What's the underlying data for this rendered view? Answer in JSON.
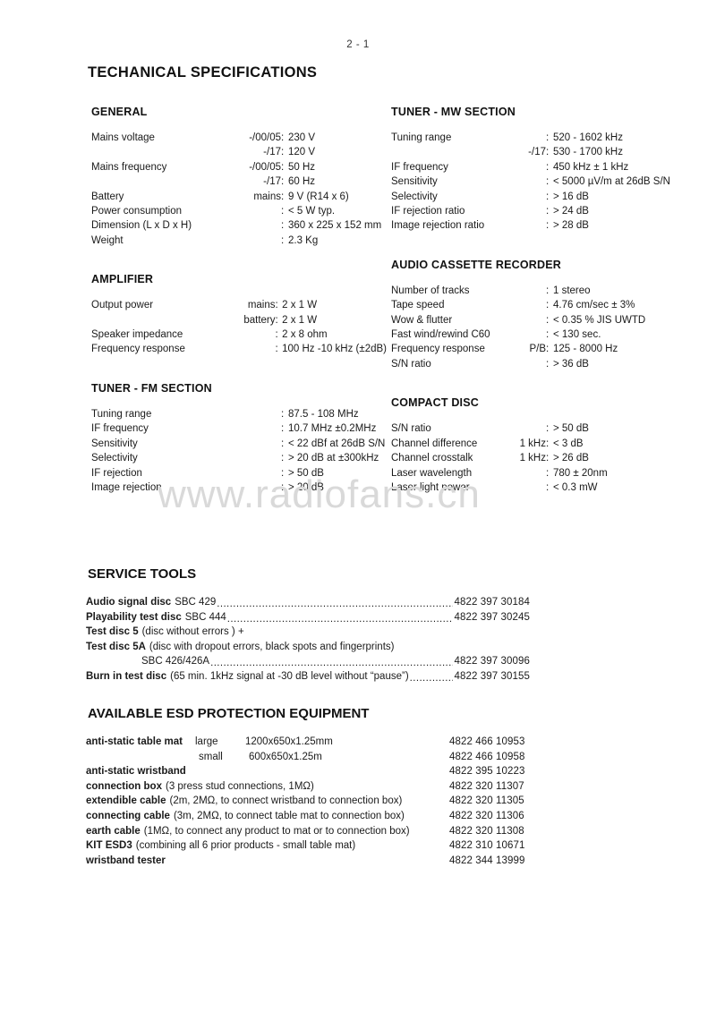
{
  "page": {
    "number": "2 - 1",
    "title": "TECHANICAL SPECIFICATIONS",
    "watermark": "www.radiofans.cn"
  },
  "sections": {
    "general": {
      "heading": "GENERAL",
      "rows": [
        {
          "label": "Mains voltage",
          "qualifier": "-/00/05",
          "sep": ":",
          "value": "230 V"
        },
        {
          "label": "",
          "qualifier": "-/17",
          "sep": ":",
          "value": "120 V"
        },
        {
          "label": "Mains frequency",
          "qualifier": "-/00/05",
          "sep": ":",
          "value": "50 Hz"
        },
        {
          "label": "",
          "qualifier": "-/17",
          "sep": ":",
          "value": " 60 Hz"
        },
        {
          "label": "Battery",
          "qualifier": "mains",
          "sep": ":",
          "value": "9 V (R14 x 6)"
        },
        {
          "label": "Power consumption",
          "qualifier": "",
          "sep": ":",
          "value": "< 5 W typ."
        },
        {
          "label": "Dimension (L x D x H)",
          "qualifier": "",
          "sep": ":",
          "value": "360 x 225 x 152 mm"
        },
        {
          "label": "Weight",
          "qualifier": "",
          "sep": ":",
          "value": "2.3 Kg"
        }
      ]
    },
    "amplifier": {
      "heading": "AMPLIFIER",
      "rows": [
        {
          "label": "Output power",
          "qualifier": "mains",
          "sep": ":",
          "value": "2 x 1 W"
        },
        {
          "label": "",
          "qualifier": "battery",
          "sep": ":",
          "value": "2 x 1 W"
        },
        {
          "label": "Speaker impedance",
          "qualifier": "",
          "sep": ":",
          "value": "2 x 8 ohm"
        },
        {
          "label": "Frequency response",
          "qualifier": "",
          "sep": ":",
          "value": "100 Hz -10 kHz (±2dB)"
        }
      ]
    },
    "tuner_fm": {
      "heading": "TUNER - FM SECTION",
      "rows": [
        {
          "label": "Tuning range",
          "qualifier": "",
          "sep": ":",
          "value": "87.5 - 108 MHz"
        },
        {
          "label": "IF frequency",
          "qualifier": "",
          "sep": ":",
          "value": "10.7 MHz ±0.2MHz"
        },
        {
          "label": "Sensitivity",
          "qualifier": "",
          "sep": ":",
          "value": "< 22 dBf at 26dB S/N"
        },
        {
          "label": "Selectivity",
          "qualifier": "",
          "sep": ":",
          "value": "> 20 dB at ±300kHz"
        },
        {
          "label": "IF rejection",
          "qualifier": "",
          "sep": ":",
          "value": "> 50 dB"
        },
        {
          "label": "Image rejection",
          "qualifier": "",
          "sep": ":",
          "value": "> 20 dB"
        }
      ]
    },
    "tuner_mw": {
      "heading": "TUNER - MW SECTION",
      "rows": [
        {
          "label": "Tuning range",
          "qualifier": "",
          "sep": ":",
          "value": "520 - 1602 kHz"
        },
        {
          "label": "",
          "qualifier": "-/17",
          "sep": ":",
          "value": "530 - 1700 kHz"
        },
        {
          "label": "IF frequency",
          "qualifier": "",
          "sep": ":",
          "value": "450 kHz ± 1 kHz"
        },
        {
          "label": "Sensitivity",
          "qualifier": "",
          "sep": ":",
          "value": "< 5000 µV/m at 26dB S/N"
        },
        {
          "label": "Selectivity",
          "qualifier": "",
          "sep": ":",
          "value": "> 16 dB"
        },
        {
          "label": "IF rejection ratio",
          "qualifier": "",
          "sep": ":",
          "value": "> 24 dB"
        },
        {
          "label": "Image rejection ratio",
          "qualifier": "",
          "sep": ":",
          "value": "> 28 dB"
        }
      ]
    },
    "cassette": {
      "heading": "AUDIO CASSETTE RECORDER",
      "rows": [
        {
          "label": "Number of tracks",
          "qualifier": "",
          "sep": ":",
          "value": "1 stereo"
        },
        {
          "label": "Tape speed",
          "qualifier": "",
          "sep": ":",
          "value": "4.76 cm/sec ± 3%"
        },
        {
          "label": "Wow & flutter",
          "qualifier": "",
          "sep": ":",
          "value": "< 0.35 %  JIS UWTD"
        },
        {
          "label": "Fast wind/rewind C60",
          "qualifier": "",
          "sep": ":",
          "value": "< 130 sec."
        },
        {
          "label": "Frequency response",
          "qualifier": "P/B",
          "sep": ":",
          "value": "125 - 8000 Hz"
        },
        {
          "label": "S/N ratio",
          "qualifier": "",
          "sep": ":",
          "value": "> 36 dB"
        }
      ]
    },
    "compact_disc": {
      "heading": "COMPACT DISC",
      "rows": [
        {
          "label": "S/N ratio",
          "qualifier": "",
          "sep": ":",
          "value": "> 50 dB"
        },
        {
          "label": "Channel difference",
          "qualifier": "1 kHz",
          "sep": ":",
          "value": "< 3 dB"
        },
        {
          "label": "Channel crosstalk",
          "qualifier": "1 kHz",
          "sep": ":",
          "value": "> 26 dB"
        },
        {
          "label": "Laser wavelength",
          "qualifier": "",
          "sep": ":",
          "value": "780 ± 20nm"
        },
        {
          "label": "Laser light power",
          "qualifier": "",
          "sep": ":",
          "value": "< 0.3 mW"
        }
      ]
    }
  },
  "service_tools": {
    "heading": "SERVICE TOOLS",
    "rows": [
      {
        "name": "Audio signal disc",
        "desc": "SBC 429",
        "leader": true,
        "code": "4822 397 30184",
        "indent": false
      },
      {
        "name": "Playability test disc",
        "desc": "SBC 444",
        "leader": true,
        "code": "4822 397 30245",
        "indent": false
      },
      {
        "name": "Test disc 5",
        "desc": "  (disc without errors ) +",
        "leader": false,
        "code": "",
        "indent": false
      },
      {
        "name": "Test disc 5A",
        "desc": "(disc with dropout errors, black spots and fingerprints)",
        "leader": false,
        "code": "",
        "indent": false
      },
      {
        "name": "",
        "desc": "SBC 426/426A",
        "leader": true,
        "code": "4822 397 30096",
        "indent": true
      },
      {
        "name": "Burn in test disc",
        "desc": "(65 min. 1kHz signal at -30 dB level without “pause”)",
        "leader": true,
        "code": "4822 397 30155",
        "indent": false
      }
    ]
  },
  "esd": {
    "heading": "AVAILABLE ESD PROTECTION EQUIPMENT",
    "rows": [
      {
        "name": "anti-static table mat",
        "size": "large",
        "desc": "1200x650x1.25mm",
        "code": "4822 466 10953"
      },
      {
        "name": "",
        "size": "small",
        "desc": "600x650x1.25m",
        "code": "4822 466 10958"
      },
      {
        "name": "anti-static wristband",
        "size": "",
        "desc": "",
        "code": "4822 395 10223"
      },
      {
        "name": "connection box",
        "size": "",
        "desc": "(3 press stud connections, 1MΩ)",
        "code": "4822 320 11307"
      },
      {
        "name": "extendible cable",
        "size": "",
        "desc": "(2m, 2MΩ, to connect wristband to connection box)",
        "code": "4822 320 11305"
      },
      {
        "name": "connecting cable",
        "size": "",
        "desc": "(3m, 2MΩ, to connect table mat to connection box)",
        "code": "4822 320 11306"
      },
      {
        "name": "earth cable",
        "size": "",
        "desc": "(1MΩ, to connect any product to mat or to connection box)",
        "code": "4822 320 11308"
      },
      {
        "name": "KIT ESD3",
        "size": "",
        "desc": "(combining all 6 prior products - small table mat)",
        "code": "4822 310 10671"
      },
      {
        "name": "wristband tester",
        "size": "",
        "desc": "",
        "code": "4822 344 13999"
      }
    ]
  }
}
